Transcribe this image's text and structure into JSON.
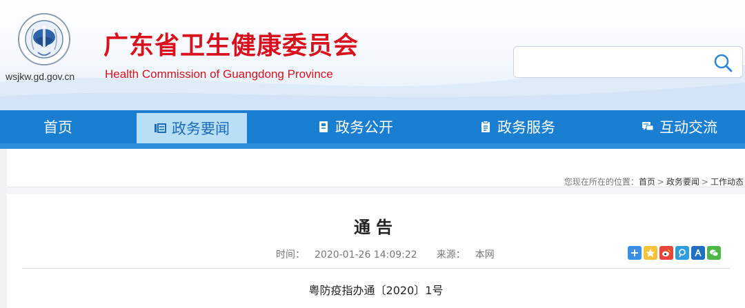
{
  "header": {
    "logo_url_text": "wsjkw.gd.gov.cn",
    "title": "广东省卫生健康委员会",
    "subtitle": "Health Commission of Guangdong Province",
    "search": {
      "value": "",
      "placeholder": ""
    }
  },
  "nav": {
    "items": [
      {
        "label": "首页",
        "icon": ""
      },
      {
        "label": "政务要闻",
        "icon": "news-icon",
        "active": true
      },
      {
        "label": "政务公开",
        "icon": "document-icon"
      },
      {
        "label": "政务服务",
        "icon": "clipboard-icon"
      },
      {
        "label": "互动交流",
        "icon": "chat-icon"
      }
    ]
  },
  "breadcrumb": {
    "prefix": "您现在所在的位置：",
    "items": [
      "首页",
      "政务要闻",
      "工作动态"
    ],
    "separator": ">"
  },
  "article": {
    "title": "通告",
    "time_label": "时间：",
    "time_value": "2020-01-26 14:09:22",
    "source_label": "来源：",
    "source_value": "本网",
    "doc_number": "粤防疫指办通〔2020〕1号"
  },
  "share": {
    "icons": [
      "share-more-icon",
      "qzone-icon",
      "weibo-icon",
      "tencent-weibo-icon",
      "renren-icon",
      "wechat-icon"
    ]
  },
  "colors": {
    "brand_red": "#d7121e",
    "nav_blue": "#1b7fd1",
    "nav_active_bg": "#b9dff7"
  }
}
